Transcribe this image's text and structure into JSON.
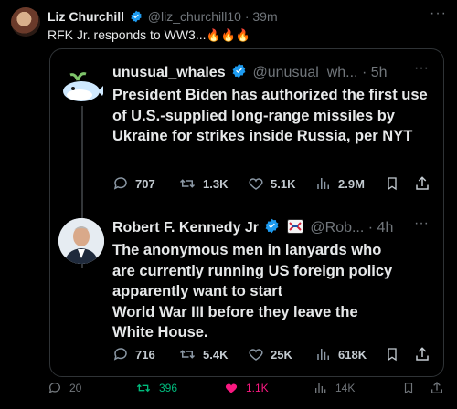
{
  "outer": {
    "author_name": "Liz Churchill",
    "handle": "@liz_churchill10",
    "time": "· 39m",
    "text": "RFK Jr. responds to WW3...",
    "emoji": "🔥🔥🔥"
  },
  "quoted": {
    "author_name": "unusual_whales",
    "handle": "@unusual_wh...",
    "time": "· 5h",
    "text": "President Biden has authorized the first use of U.S.-supplied long-range missiles by Ukraine for strikes inside Russia, per NYT",
    "replies": "707",
    "reposts": "1.3K",
    "likes": "5.1K",
    "views": "2.9M"
  },
  "reply": {
    "author_name": "Robert F. Kennedy Jr",
    "handle": "@Rob...",
    "time": "· 4h",
    "text_lines": [
      "The anonymous men in lanyards who",
      "are currently running US foreign policy",
      "apparently want to start",
      "World War III before they leave the",
      "White House."
    ],
    "replies": "716",
    "reposts": "5.4K",
    "likes": "25K",
    "views": "618K"
  },
  "footer": {
    "replies": "20",
    "reposts": "396",
    "likes": "1.1K",
    "views": "14K"
  },
  "colors": {
    "accent_blue": "#1d9bf0",
    "repost_green": "#00ba7c",
    "like_pink": "#f91880",
    "muted": "#71767b"
  }
}
